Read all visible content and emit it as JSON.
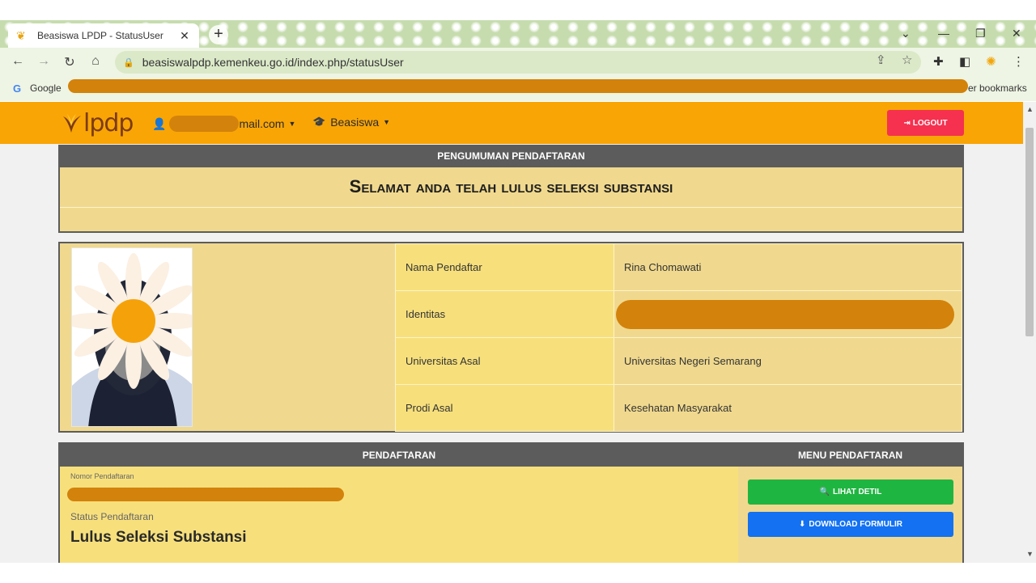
{
  "browser": {
    "tab_title": "Beasiswa LPDP - StatusUser",
    "tab_close": "✕",
    "new_tab": "+",
    "url": "beasiswalpdp.kemenkeu.go.id/index.php/statusUser",
    "bookmark_google": "Google",
    "bookmark_other": "er bookmarks"
  },
  "navbar": {
    "logo_text": "lpdp",
    "user_email_suffix": "mail.com",
    "beasiswa_label": "Beasiswa",
    "logout_label": "LOGOUT"
  },
  "announcement": {
    "header": "PENGUMUMAN PENDAFTARAN",
    "title": "Selamat anda telah lulus seleksi substansi"
  },
  "profile": {
    "rows": [
      {
        "label": "Nama Pendaftar",
        "value": "Rina Chomawati"
      },
      {
        "label": "Identitas",
        "value": ""
      },
      {
        "label": "Universitas Asal",
        "value": "Universitas Negeri Semarang"
      },
      {
        "label": "Prodi Asal",
        "value": "Kesehatan Masyarakat"
      }
    ]
  },
  "registration": {
    "header_left": "PENDAFTARAN",
    "header_right": "MENU PENDAFTARAN",
    "nomor_label": "Nomor Pendaftaran",
    "status_label": "Status Pendaftaran",
    "status_value": "Lulus Seleksi Substansi",
    "btn_detail": "LIHAT DETIL",
    "btn_download": "DOWNLOAD FORMULIR"
  },
  "colors": {
    "navbar": "#f9a506",
    "logout": "#f5314f",
    "panel_header": "#5c5c5c",
    "panel_bg": "#f0d98e",
    "btn_green": "#1fb541",
    "btn_blue": "#1371f2",
    "redaction": "#d3820b"
  }
}
